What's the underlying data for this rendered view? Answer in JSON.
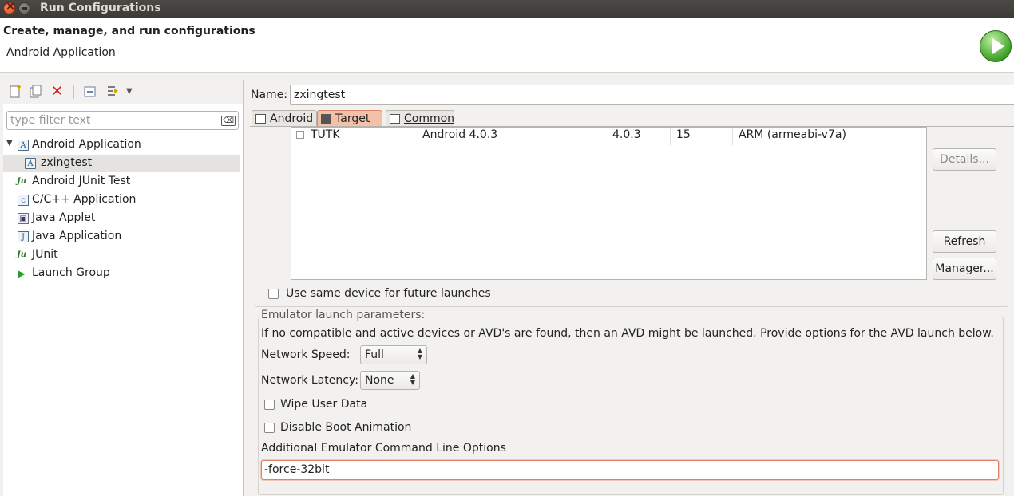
{
  "window": {
    "title": "Run Configurations"
  },
  "header": {
    "title": "Create, manage, and run configurations",
    "subtitle": "Android Application"
  },
  "left": {
    "filter_placeholder": "type filter text",
    "tree": [
      {
        "label": "Android Application",
        "icon": "android-app-icon",
        "expanded": true
      },
      {
        "label": "zxingtest",
        "icon": "config-icon",
        "selected": true
      },
      {
        "label": "Android JUnit Test",
        "icon": "junit-icon"
      },
      {
        "label": "C/C++ Application",
        "icon": "c-app-icon"
      },
      {
        "label": "Java Applet",
        "icon": "applet-icon"
      },
      {
        "label": "Java Application",
        "icon": "java-app-icon"
      },
      {
        "label": "JUnit",
        "icon": "junit-icon"
      },
      {
        "label": "Launch Group",
        "icon": "launch-icon"
      }
    ]
  },
  "right": {
    "name_label": "Name:",
    "name_value": "zxingtest",
    "tabs": [
      {
        "label": "Android"
      },
      {
        "label": "Target",
        "active": true
      },
      {
        "label": "Common"
      }
    ],
    "device_row": {
      "name": "TUTK",
      "target": "Android 4.0.3",
      "platform": "4.0.3",
      "api": "15",
      "cpu": "ARM (armeabi-v7a)"
    },
    "buttons": {
      "details": "Details...",
      "refresh": "Refresh",
      "manager": "Manager..."
    },
    "same_device_label": "Use same device for future launches",
    "emulator": {
      "legend": "Emulator launch parameters:",
      "description": "If no compatible and active devices or AVD's are found, then an AVD might be launched. Provide options for the AVD launch below.",
      "speed_label": "Network Speed:",
      "speed_value": "Full",
      "latency_label": "Network Latency:",
      "latency_value": "None",
      "wipe_label": "Wipe User Data",
      "boot_label": "Disable Boot Animation",
      "cmd_label": "Additional Emulator Command Line Options",
      "cmd_value": "-force-32bit"
    }
  }
}
